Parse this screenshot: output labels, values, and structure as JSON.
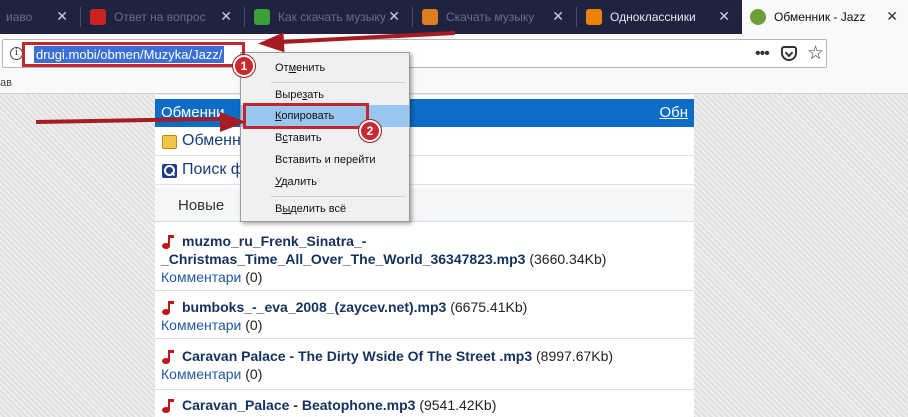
{
  "tabs": [
    {
      "title": "иаво",
      "close": "✕",
      "icon_color": "#3a5a98"
    },
    {
      "title": "Ответ на вопрос",
      "close": "✕",
      "icon_color": "#cc2222"
    },
    {
      "title": "Как скачать музыку",
      "close": "✕",
      "icon_color": "#3aa03a"
    },
    {
      "title": "Скачать музыку",
      "close": "✕",
      "icon_color": "#e07d21"
    },
    {
      "title": "Одноклассники",
      "close": "✕",
      "icon_color": "#ee8208"
    },
    {
      "title": "Обменник - Jazz",
      "close": "✕",
      "icon_color": "#6b9f3a"
    }
  ],
  "urlbar": {
    "url": "drugi.mobi/obmen/Muzyka/Jazz/",
    "info_glyph": "i",
    "more_glyph": "•••",
    "star_glyph": "☆"
  },
  "bookmarks_fragment": "ав",
  "header": {
    "title": "Обменни",
    "right_link": "Обн"
  },
  "nav": {
    "obmennik": "Обменн",
    "search": "Поиск ф",
    "tab_new": "Новые"
  },
  "files": [
    {
      "line1": "muzmo_ru_Frenk_Sinatra_-",
      "line2": "_Christmas_Time_All_Over_The_World_36347823.mp3",
      "size": "(3660.34Kb)",
      "comments_label": "Комментари",
      "comments_count": "(0)"
    },
    {
      "line1": "bumboks_-_eva_2008_(zaycev.net).mp3",
      "size": "(6675.41Kb)",
      "comments_label": "Комментари",
      "comments_count": "(0)"
    },
    {
      "line1": "Caravan Palace - The Dirty Wside Of The Street .mp3",
      "size": "(8997.67Kb)",
      "comments_label": "Комментари",
      "comments_count": "(0)"
    },
    {
      "line1": "Caravan_Palace - Beatophone.mp3",
      "size": "(9541.42Kb)"
    }
  ],
  "context_menu": {
    "undo": {
      "pre": "От",
      "key": "м",
      "post": "енить"
    },
    "cut": {
      "pre": "Выре",
      "key": "з",
      "post": "ать"
    },
    "copy": {
      "pre": "",
      "key": "К",
      "post": "опировать"
    },
    "paste": {
      "pre": "В",
      "key": "с",
      "post": "тавить"
    },
    "paste_go": {
      "pre": "",
      "key": "",
      "post": "Вставить и перейти"
    },
    "delete": {
      "pre": "",
      "key": "У",
      "post": "далить"
    },
    "select_all": {
      "pre": "В",
      "key": "ы",
      "post": "делить всё"
    }
  },
  "annotations": {
    "badge1": "1",
    "badge2": "2",
    "color": "#c3272b"
  }
}
